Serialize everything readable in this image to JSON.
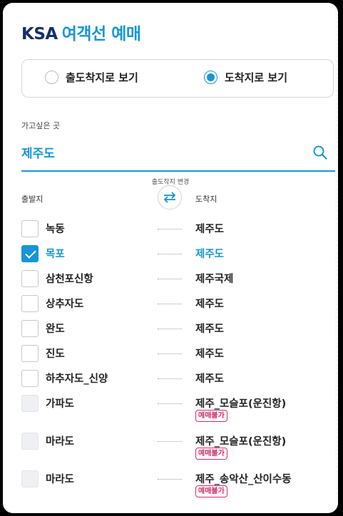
{
  "header": {
    "brand": "KSA",
    "subtitle": "여객선 예매"
  },
  "view_mode": {
    "options": [
      {
        "label": "출도착지로 보기",
        "selected": false
      },
      {
        "label": "도착지로 보기",
        "selected": true
      }
    ]
  },
  "destination": {
    "label": "가고싶은 곳",
    "value": "제주도",
    "icon": "search-icon"
  },
  "swap": {
    "caption": "출도착지 변경",
    "icon": "swap-arrows-icon"
  },
  "columns": {
    "departure": "출발지",
    "arrival": "도착지"
  },
  "routes": [
    {
      "departure": "녹동",
      "arrival": "제주도",
      "checked": false,
      "disabled": false,
      "badge": ""
    },
    {
      "departure": "목포",
      "arrival": "제주도",
      "checked": true,
      "disabled": false,
      "badge": ""
    },
    {
      "departure": "삼천포신항",
      "arrival": "제주국제",
      "checked": false,
      "disabled": false,
      "badge": ""
    },
    {
      "departure": "상추자도",
      "arrival": "제주도",
      "checked": false,
      "disabled": false,
      "badge": ""
    },
    {
      "departure": "완도",
      "arrival": "제주도",
      "checked": false,
      "disabled": false,
      "badge": ""
    },
    {
      "departure": "진도",
      "arrival": "제주도",
      "checked": false,
      "disabled": false,
      "badge": ""
    },
    {
      "departure": "하추자도_신양",
      "arrival": "제주도",
      "checked": false,
      "disabled": false,
      "badge": ""
    },
    {
      "departure": "가파도",
      "arrival": "제주_모슬포(운진항)",
      "checked": false,
      "disabled": true,
      "badge": "예매불가"
    },
    {
      "departure": "마라도",
      "arrival": "제주_모슬포(운진항)",
      "checked": false,
      "disabled": true,
      "badge": "예매불가"
    },
    {
      "departure": "마라도",
      "arrival": "제주_송악산_산이수동",
      "checked": false,
      "disabled": true,
      "badge": "예매불가"
    }
  ],
  "colors": {
    "accent": "#1596d6",
    "brand": "#13306b",
    "warning": "#d42d6a"
  }
}
